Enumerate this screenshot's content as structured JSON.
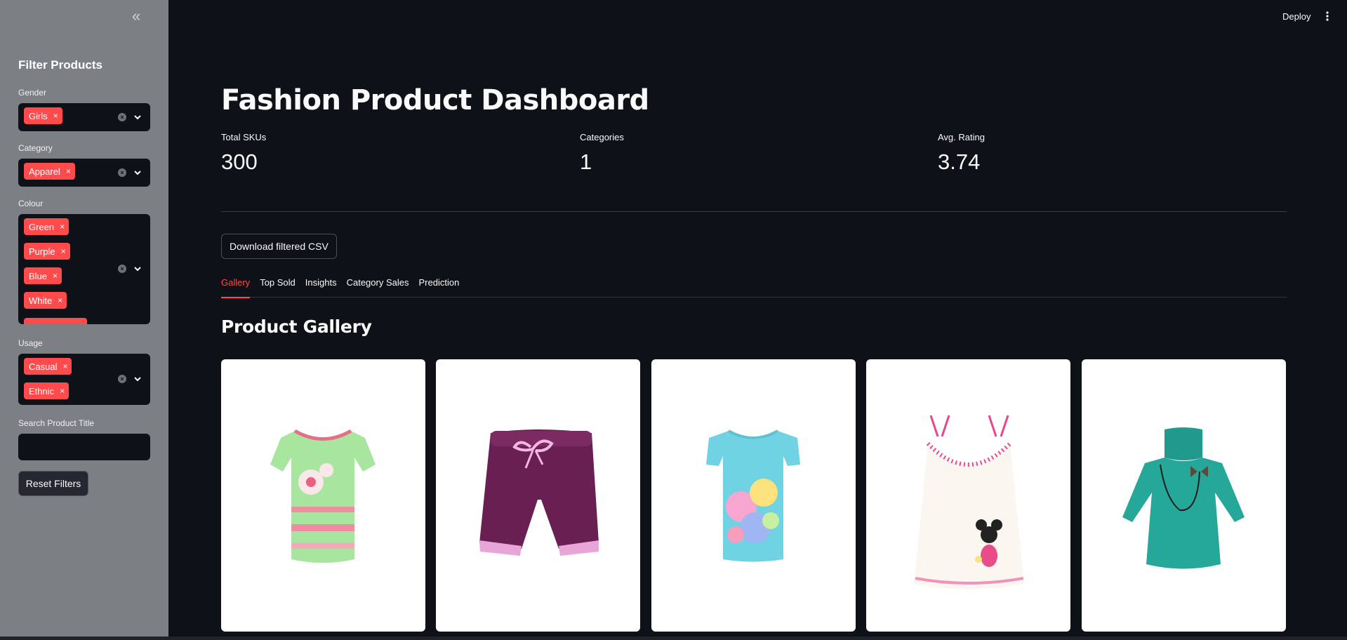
{
  "sidebar": {
    "title": "Filter Products",
    "gender": {
      "label": "Gender",
      "chips": [
        "Girls"
      ]
    },
    "category": {
      "label": "Category",
      "chips": [
        "Apparel"
      ]
    },
    "colour": {
      "label": "Colour",
      "chips": [
        "Green",
        "Purple",
        "Blue",
        "White"
      ]
    },
    "usage": {
      "label": "Usage",
      "chips": [
        "Casual",
        "Ethnic"
      ]
    },
    "search": {
      "label": "Search Product Title",
      "value": ""
    },
    "reset_label": "Reset Filters",
    "chip_remove": "×"
  },
  "header": {
    "deploy_label": "Deploy"
  },
  "main": {
    "title": "Fashion Product Dashboard",
    "metrics": [
      {
        "label": "Total SKUs",
        "value": "300"
      },
      {
        "label": "Categories",
        "value": "1"
      },
      {
        "label": "Avg. Rating",
        "value": "3.74"
      }
    ],
    "download_label": "Download filtered CSV",
    "tabs": [
      "Gallery",
      "Top Sold",
      "Insights",
      "Category Sales",
      "Prediction"
    ],
    "active_tab": "Gallery",
    "section_title": "Product Gallery",
    "products": [
      {
        "image": "green-floral-tshirt",
        "color": "#a8e6a0"
      },
      {
        "image": "purple-shorts",
        "color": "#6a1f52"
      },
      {
        "image": "blue-printed-tshirt",
        "color": "#6fd3e3"
      },
      {
        "image": "minnie-white-camisole",
        "color": "#fbf7f0"
      },
      {
        "image": "teal-turtleneck-dress",
        "color": "#25a89a"
      }
    ]
  },
  "colors": {
    "accent": "#ff4b4b",
    "background": "#0e1117",
    "sidebar": "#7c7f83"
  }
}
